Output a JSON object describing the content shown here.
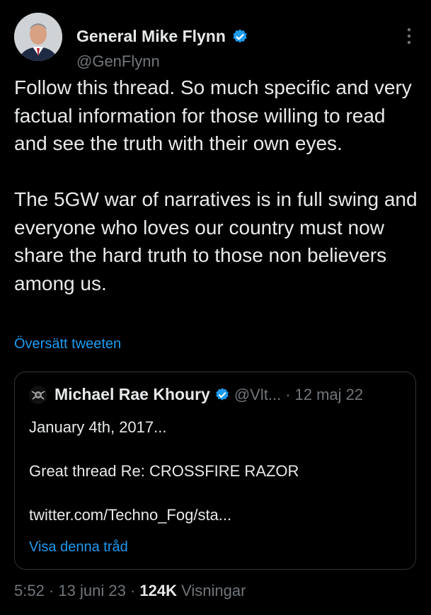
{
  "author": {
    "name": "General Mike Flynn",
    "handle": "@GenFlynn"
  },
  "tweet": {
    "text": "Follow this thread. So much specific and very factual information for those willing to read and see the truth with their own eyes.\n\nThe 5GW war of narratives is in full swing and everyone who loves our country must now share the hard truth to those non believers among us.",
    "translate_label": "Översätt tweeten"
  },
  "quoted": {
    "name": "Michael Rae Khoury",
    "handle": "@Vlt...",
    "separator": "·",
    "date": "12 maj 22",
    "lines": [
      "January 4th, 2017...",
      "",
      "Great thread Re: CROSSFIRE RAZOR",
      "",
      "twitter.com/Techno_Fog/sta..."
    ],
    "show_thread_label": "Visa denna tråd"
  },
  "meta": {
    "time": "5:52",
    "sep1": "·",
    "date": "13 juni 23",
    "sep2": "·",
    "views_count": "124K",
    "views_label": "Visningar"
  },
  "colors": {
    "background": "#000000",
    "text": "#e7e9ea",
    "secondary": "#71767b",
    "accent": "#1d9bf0",
    "border": "#2f3336"
  },
  "icons": {
    "verified": "verified-badge-icon",
    "more": "more-options-icon"
  }
}
